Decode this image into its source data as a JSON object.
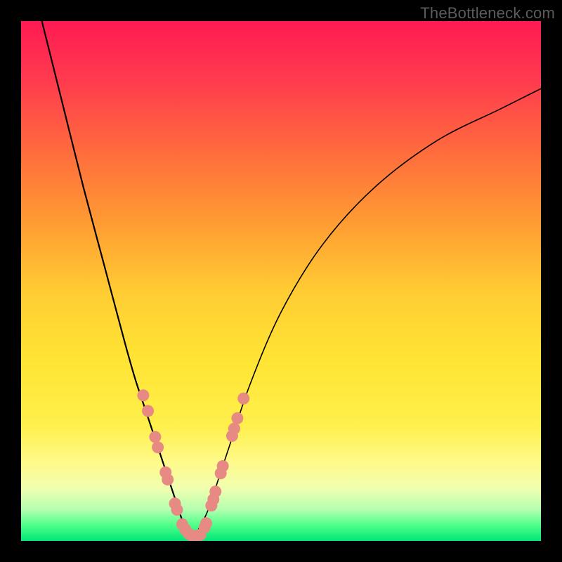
{
  "attribution": "TheBottleneck.com",
  "colors": {
    "dot": "#e88a84",
    "curve": "#000000",
    "frame": "#000000"
  },
  "chart_data": {
    "type": "line",
    "title": "",
    "xlabel": "",
    "ylabel": "",
    "xlim": [
      0,
      100
    ],
    "ylim": [
      0,
      100
    ],
    "series": [
      {
        "name": "left-curve",
        "x": [
          4,
          8,
          12,
          16,
          20,
          22,
          24,
          26,
          28,
          30,
          31,
          32,
          33
        ],
        "y": [
          100,
          84,
          68,
          53,
          38,
          31,
          25,
          19,
          13,
          7,
          4,
          2,
          1
        ]
      },
      {
        "name": "right-curve",
        "x": [
          33,
          34,
          36,
          38,
          40,
          44,
          50,
          58,
          68,
          80,
          92,
          100
        ],
        "y": [
          1,
          2,
          6,
          12,
          18,
          30,
          44,
          57,
          68,
          77,
          83,
          87
        ]
      }
    ],
    "markers": {
      "name": "highlighted-points",
      "points": [
        {
          "x": 23.5,
          "y": 28
        },
        {
          "x": 24.4,
          "y": 25
        },
        {
          "x": 25.8,
          "y": 20
        },
        {
          "x": 26.3,
          "y": 18
        },
        {
          "x": 27.8,
          "y": 13.2
        },
        {
          "x": 28.2,
          "y": 11.8
        },
        {
          "x": 29.6,
          "y": 7.2
        },
        {
          "x": 30.0,
          "y": 6.0
        },
        {
          "x": 31.0,
          "y": 3.2
        },
        {
          "x": 31.6,
          "y": 2.2
        },
        {
          "x": 32.2,
          "y": 1.4
        },
        {
          "x": 32.9,
          "y": 1.0
        },
        {
          "x": 33.8,
          "y": 1.0
        },
        {
          "x": 34.5,
          "y": 1.2
        },
        {
          "x": 35.3,
          "y": 2.6
        },
        {
          "x": 35.6,
          "y": 3.4
        },
        {
          "x": 36.6,
          "y": 6.8
        },
        {
          "x": 37.0,
          "y": 8.0
        },
        {
          "x": 37.4,
          "y": 9.5
        },
        {
          "x": 38.4,
          "y": 13.0
        },
        {
          "x": 38.8,
          "y": 14.4
        },
        {
          "x": 40.6,
          "y": 20.2
        },
        {
          "x": 41.0,
          "y": 21.6
        },
        {
          "x": 41.6,
          "y": 23.6
        },
        {
          "x": 42.8,
          "y": 27.4
        }
      ]
    }
  }
}
